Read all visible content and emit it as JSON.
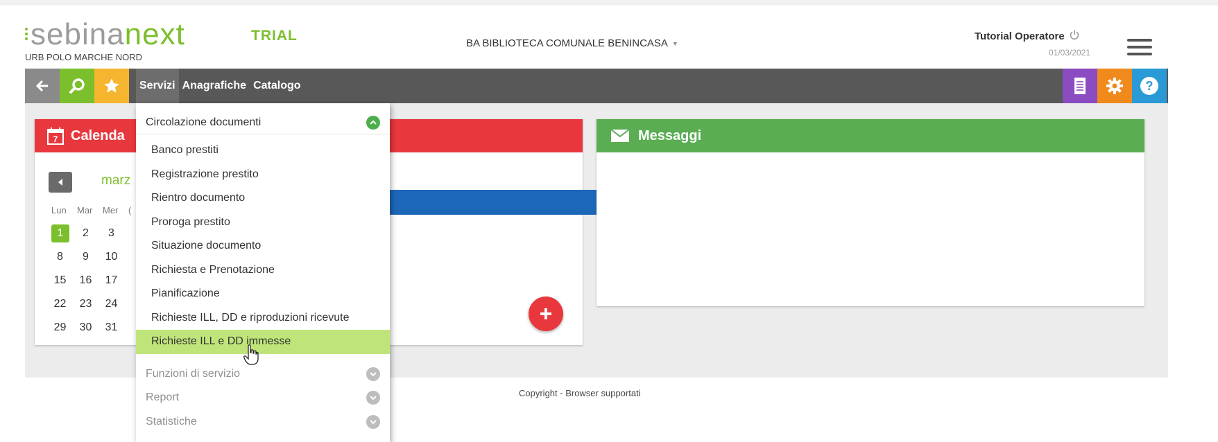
{
  "header": {
    "logo_part1": "sebina",
    "logo_part2": "next",
    "trial_label": "TRIAL",
    "polo": "URB POLO MARCHE NORD",
    "library": "BA BIBLIOTECA COMUNALE BENINCASA",
    "user": "Tutorial Operatore",
    "date": "01/03/2021"
  },
  "toolbar": {
    "nav": [
      "Servizi",
      "Anagrafiche",
      "Catalogo"
    ]
  },
  "calendar": {
    "title": "Calendario",
    "title_visible": "Calenda",
    "month": "marz",
    "weekdays": [
      "Lun",
      "Mar",
      "Mer",
      "("
    ],
    "weeks": [
      [
        "1",
        "2",
        "3"
      ],
      [
        "8",
        "9",
        "10"
      ],
      [
        "15",
        "16",
        "17"
      ],
      [
        "22",
        "23",
        "24"
      ],
      [
        "29",
        "30",
        "31"
      ]
    ]
  },
  "messages": {
    "title": "Messaggi"
  },
  "menu": {
    "section_open": "Circolazione documenti",
    "items": [
      "Banco prestiti",
      "Registrazione prestito",
      "Rientro documento",
      "Proroga prestito",
      "Situazione documento",
      "Richiesta e Prenotazione",
      "Pianificazione",
      "Richieste ILL, DD e riproduzioni ricevute",
      "Richieste ILL e DD immesse"
    ],
    "sections_closed": [
      "Funzioni di servizio",
      "Report",
      "Statistiche"
    ]
  },
  "footer": {
    "copyright": "Copyright - Browser supportati"
  },
  "colors": {
    "brand_green": "#7cbf2d",
    "calendar_red": "#e8383d",
    "messages_green": "#5aad52",
    "toolbar_gray": "#585858",
    "highlight": "#bfe57a"
  }
}
